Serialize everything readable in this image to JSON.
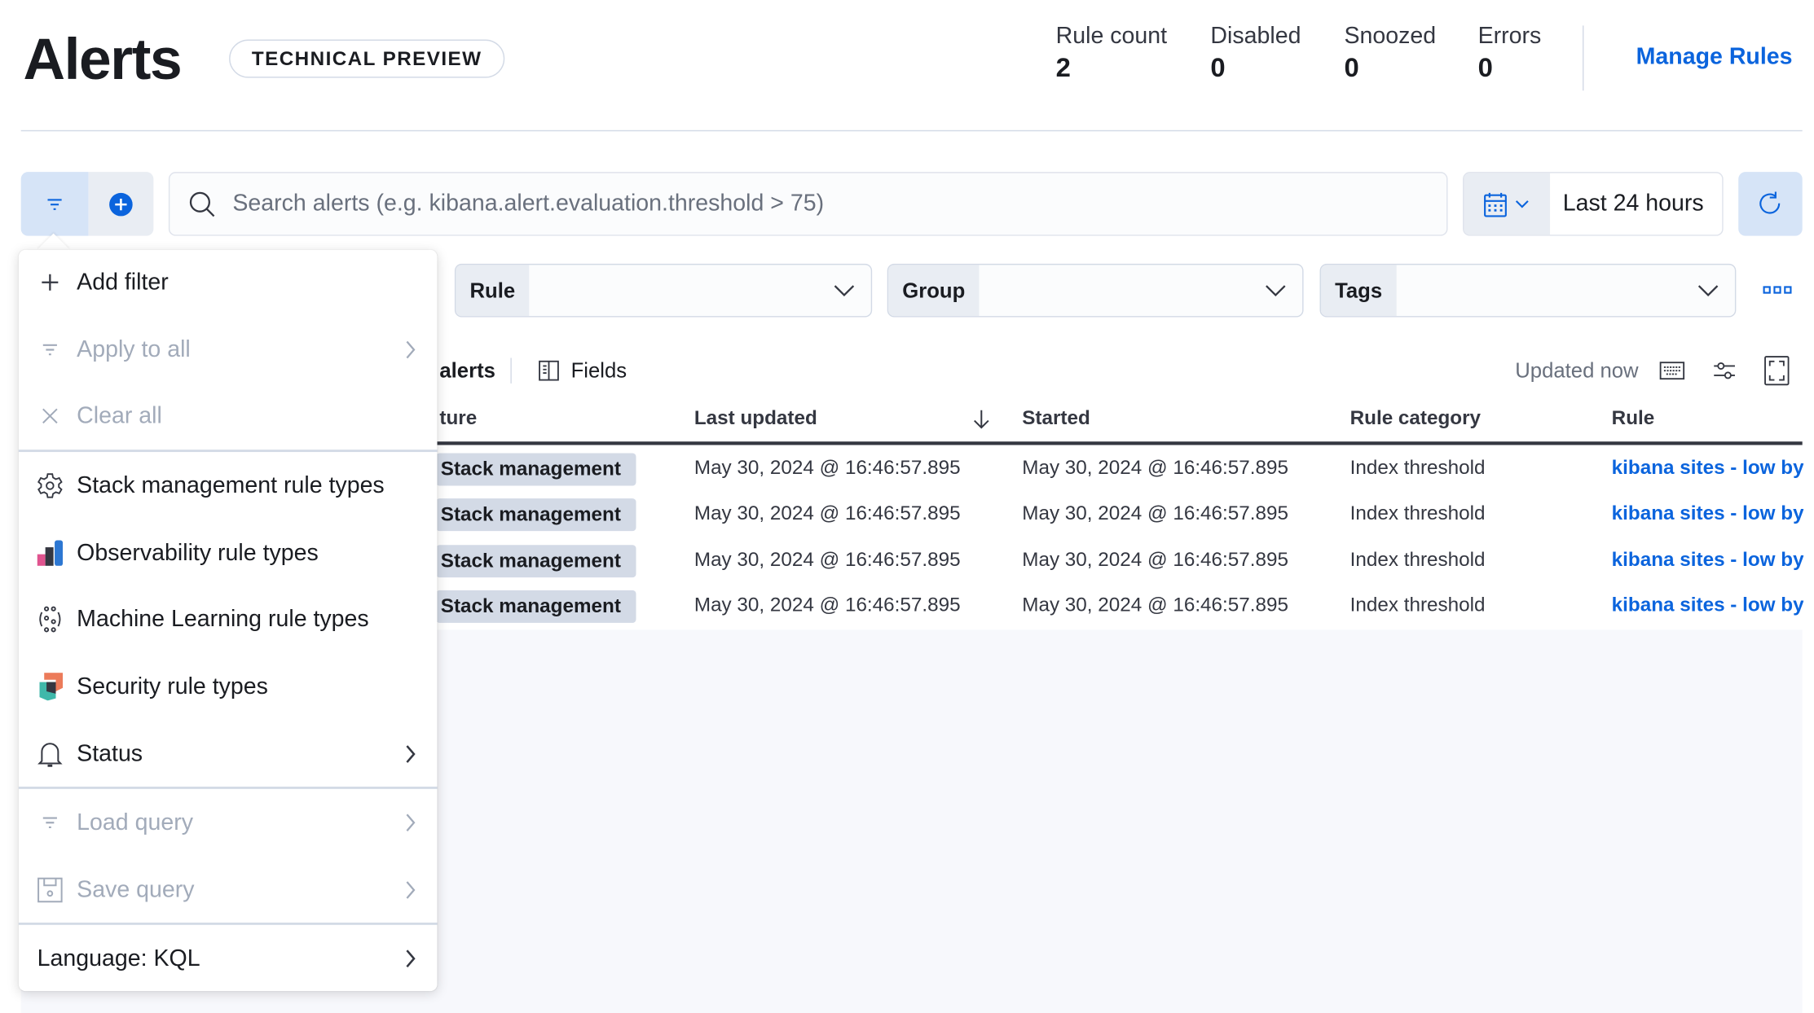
{
  "header": {
    "title": "Alerts",
    "badge": "TECHNICAL PREVIEW",
    "manage_rules": "Manage Rules",
    "stats": [
      {
        "label": "Rule count",
        "value": "2"
      },
      {
        "label": "Disabled",
        "value": "0"
      },
      {
        "label": "Snoozed",
        "value": "0"
      },
      {
        "label": "Errors",
        "value": "0"
      }
    ]
  },
  "search": {
    "placeholder": "Search alerts (e.g. kibana.alert.evaluation.threshold > 75)",
    "value": ""
  },
  "date_picker": {
    "label": "Last 24 hours"
  },
  "controls": [
    {
      "label": "Rule"
    },
    {
      "label": "Group"
    },
    {
      "label": "Tags"
    }
  ],
  "toolbar": {
    "alerts_label": "alerts",
    "fields_label": "Fields",
    "updated": "Updated now"
  },
  "table": {
    "columns": [
      "ture",
      "Last updated",
      "Started",
      "Rule category",
      "Rule"
    ],
    "rows": [
      {
        "feature": "Stack management",
        "last_updated": "May 30, 2024 @ 16:46:57.895",
        "started": "May 30, 2024 @ 16:46:57.895",
        "category": "Index threshold",
        "rule": "kibana sites - low by"
      },
      {
        "feature": "Stack management",
        "last_updated": "May 30, 2024 @ 16:46:57.895",
        "started": "May 30, 2024 @ 16:46:57.895",
        "category": "Index threshold",
        "rule": "kibana sites - low by"
      },
      {
        "feature": "Stack management",
        "last_updated": "May 30, 2024 @ 16:46:57.895",
        "started": "May 30, 2024 @ 16:46:57.895",
        "category": "Index threshold",
        "rule": "kibana sites - low by"
      },
      {
        "feature": "Stack management",
        "last_updated": "May 30, 2024 @ 16:46:57.895",
        "started": "May 30, 2024 @ 16:46:57.895",
        "category": "Index threshold",
        "rule": "kibana sites - low by"
      }
    ]
  },
  "menu": {
    "add_filter": "Add filter",
    "apply_all": "Apply to all",
    "clear_all": "Clear all",
    "stack": "Stack management rule types",
    "observability": "Observability rule types",
    "ml": "Machine Learning rule types",
    "security": "Security rule types",
    "status": "Status",
    "load_query": "Load query",
    "save_query": "Save query",
    "language": "Language: KQL"
  },
  "colors": {
    "accent": "#0b64dd",
    "text": "#1a1c21",
    "disabled": "#a2abba"
  }
}
